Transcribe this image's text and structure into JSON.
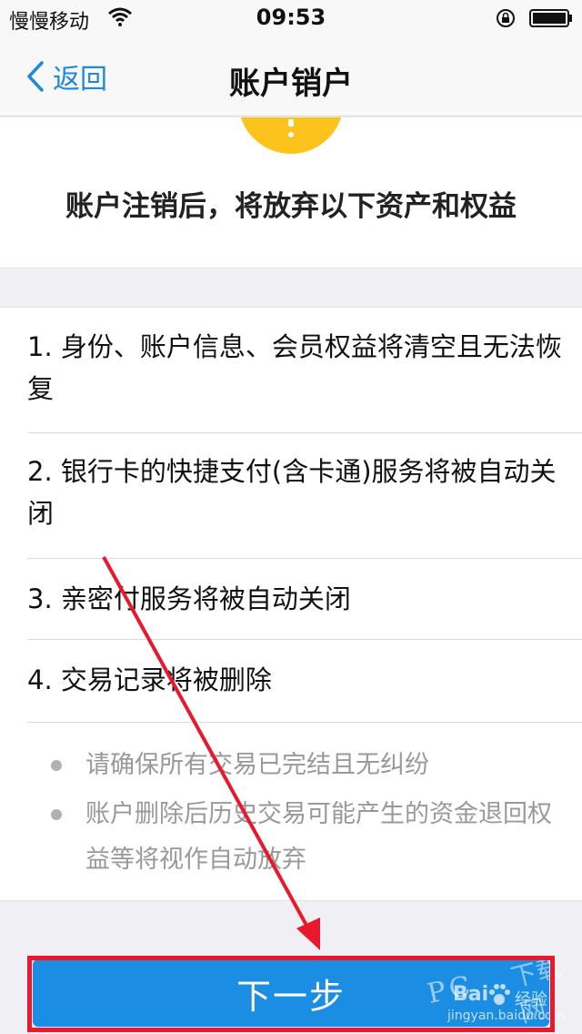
{
  "status_bar": {
    "carrier": "慢慢移动",
    "time": "09:53"
  },
  "nav": {
    "back_label": "返回",
    "title": "账户销户"
  },
  "warning": {
    "heading": "账户注销后，将放弃以下资产和权益"
  },
  "items": [
    "1. 身份、账户信息、会员权益将清空且无法恢复",
    "2. 银行卡的快捷支付(含卡通)服务将被自动关闭",
    "3. 亲密付服务将被自动关闭",
    "4. 交易记录将被删除"
  ],
  "notes": [
    "请确保所有交易已完结且无纠纷",
    "账户删除后历史交易可能产生的资金退回权益等将视作自动放弃"
  ],
  "next_button": {
    "label": "下一步"
  },
  "watermark": {
    "pc": "PC",
    "download": "下载网",
    "baidu": "Bai",
    "jingyan": "经验",
    "url": "jingyan.baidu.com"
  },
  "colors": {
    "accent": "#1b8ee3",
    "warning_icon": "#fbc31b",
    "annotation_red": "#e8192c"
  }
}
